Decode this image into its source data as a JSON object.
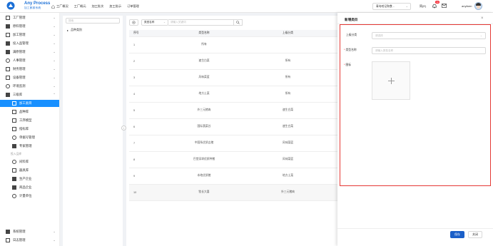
{
  "brand": {
    "name": "Any Process",
    "subtitle": "加工數據系統"
  },
  "topnav": {
    "items": [
      "工厂概況",
      "工厂概元",
      "加工批次",
      "加工批示",
      "订单管理"
    ]
  },
  "header": {
    "org_select": "青岛哈记和食…",
    "language": "简(E)",
    "notification_count": "99",
    "username": "anyfarm"
  },
  "sidebar": {
    "items": [
      {
        "label": "工厂管理",
        "icon": "grid-icon"
      },
      {
        "label": "原料管理",
        "icon": "box-icon"
      },
      {
        "label": "加工管理",
        "icon": "tools-icon"
      },
      {
        "label": "投入品管理",
        "icon": "input-icon"
      },
      {
        "label": "满原管理",
        "icon": "stack-icon"
      },
      {
        "label": "人事管理",
        "icon": "person-icon"
      },
      {
        "label": "财务管理",
        "icon": "wallet-icon"
      },
      {
        "label": "设备管理",
        "icon": "monitor-icon"
      },
      {
        "label": "环境监测",
        "icon": "gear-icon"
      },
      {
        "label": "三级库",
        "icon": "library-icon"
      }
    ],
    "sub_items": [
      {
        "label": "加工类目",
        "icon": "category-icon",
        "active": true
      },
      {
        "label": "品种库",
        "icon": "table-icon"
      },
      {
        "label": "工序模型",
        "icon": "model-icon"
      },
      {
        "label": "指标库",
        "icon": "flag-icon"
      },
      {
        "label": "单据号管理",
        "icon": "doc-icon"
      },
      {
        "label": "专家管理",
        "icon": "expert-icon"
      }
    ],
    "group_label": "投入品库",
    "group_items": [
      {
        "label": "间料库",
        "icon": "circle-icon"
      },
      {
        "label": "器具库",
        "icon": "tool-icon"
      },
      {
        "label": "生产企业",
        "icon": "factory-icon"
      },
      {
        "label": "商品企业",
        "icon": "shop-icon"
      },
      {
        "label": "计量单位",
        "icon": "pin-icon"
      }
    ],
    "bottom_items": [
      {
        "label": "系统管理",
        "icon": "system-icon"
      },
      {
        "label": "日志管理",
        "icon": "log-icon"
      }
    ]
  },
  "tree": {
    "search_placeholder": "搜索",
    "root_label": "品种类别"
  },
  "toolbar": {
    "field_select": "类型名称",
    "search_placeholder": "请输入关键词"
  },
  "table": {
    "columns": [
      "序号",
      "类型名称",
      "上级分类"
    ],
    "rows": [
      {
        "idx": "1",
        "name": "所有",
        "parent": ""
      },
      {
        "idx": "2",
        "name": "速生白菜",
        "parent": "所有"
      },
      {
        "idx": "3",
        "name": "风味菜篮",
        "parent": "所有"
      },
      {
        "idx": "4",
        "name": "地方土菜",
        "parent": "所有"
      },
      {
        "idx": "5",
        "name": "外三元猪肉",
        "parent": "速生白菜"
      },
      {
        "idx": "6",
        "name": "国际蔬菜谷",
        "parent": "速生白菜"
      },
      {
        "idx": "7",
        "name": "中国系优质吉猪",
        "parent": "风味菜篮"
      },
      {
        "idx": "8",
        "name": "巴堂深圳优质种猪",
        "parent": "风味菜篮"
      },
      {
        "idx": "9",
        "name": "本地优质猪",
        "parent": "地方土菜"
      },
      {
        "idx": "10",
        "name": "牧长大喜",
        "parent": "外三元猪肉"
      }
    ]
  },
  "drawer": {
    "title": "新增类目",
    "fields": {
      "parent_label": "上级分类",
      "parent_placeholder": "请选择",
      "name_label": "类型名称",
      "name_placeholder": "请输入类型名称",
      "image_label": "图标"
    },
    "save_label": "保存",
    "close_label": "关闭"
  },
  "colors": {
    "accent": "#1890ff",
    "primary_button": "#1a5fc8",
    "highlight": "#e53935"
  }
}
